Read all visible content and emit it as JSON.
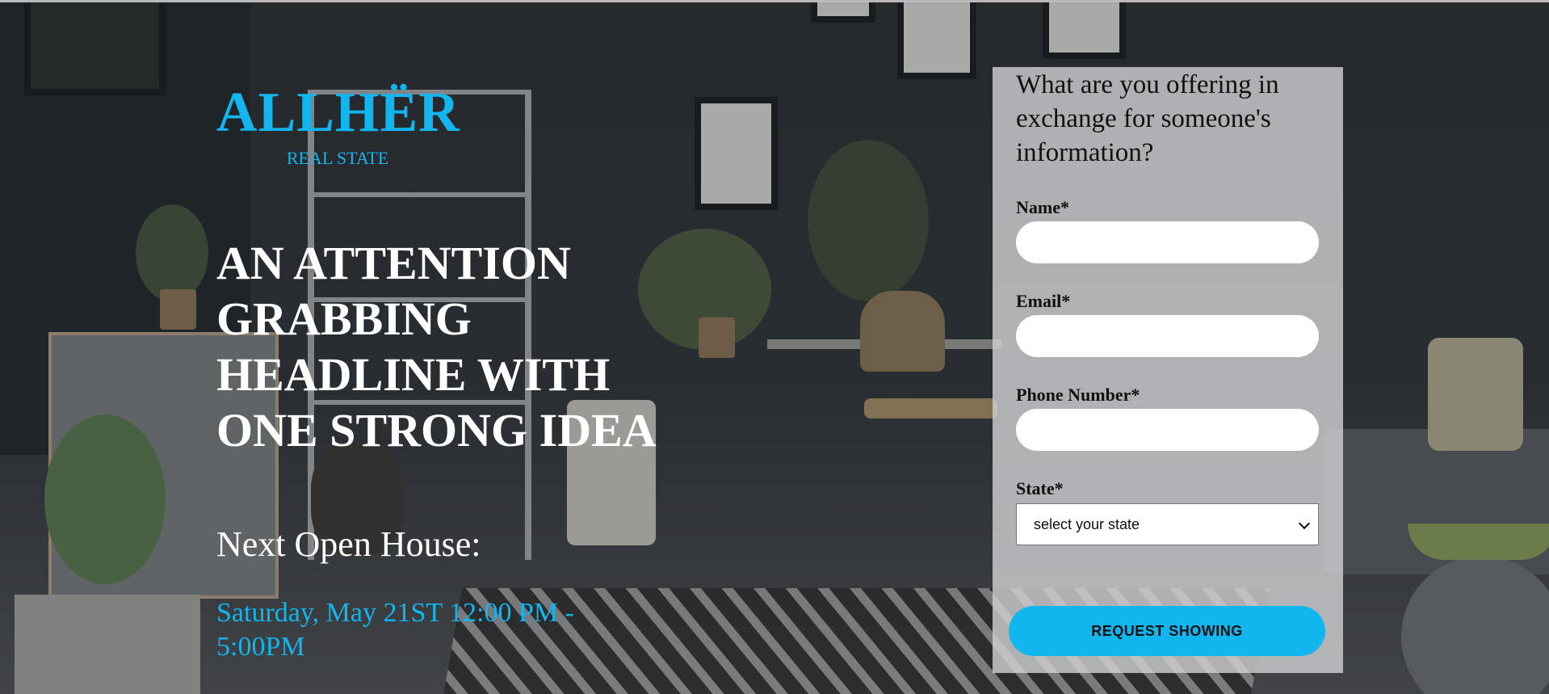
{
  "brand": {
    "name": "ALLHËR",
    "tagline": "REAL STATE",
    "accent_color": "#12b6ef"
  },
  "hero": {
    "headline": "AN ATTENTION GRABBING HEADLINE WITH ONE STRONG IDEA",
    "open_house_label": "Next Open House:",
    "open_house_date": "Saturday, May 21ST 12:00 PM - 5:00PM"
  },
  "form": {
    "title": "What are you offering in exchange for someone's information?",
    "fields": {
      "name": {
        "label": "Name*",
        "value": ""
      },
      "email": {
        "label": "Email*",
        "value": ""
      },
      "phone": {
        "label": "Phone Number*",
        "value": ""
      },
      "state": {
        "label": "State*",
        "selected": "select your state"
      }
    },
    "submit_label": "REQUEST SHOWING",
    "submit_color": "#12b6ef"
  },
  "icons": {
    "state_dropdown": "chevron-down-icon"
  }
}
